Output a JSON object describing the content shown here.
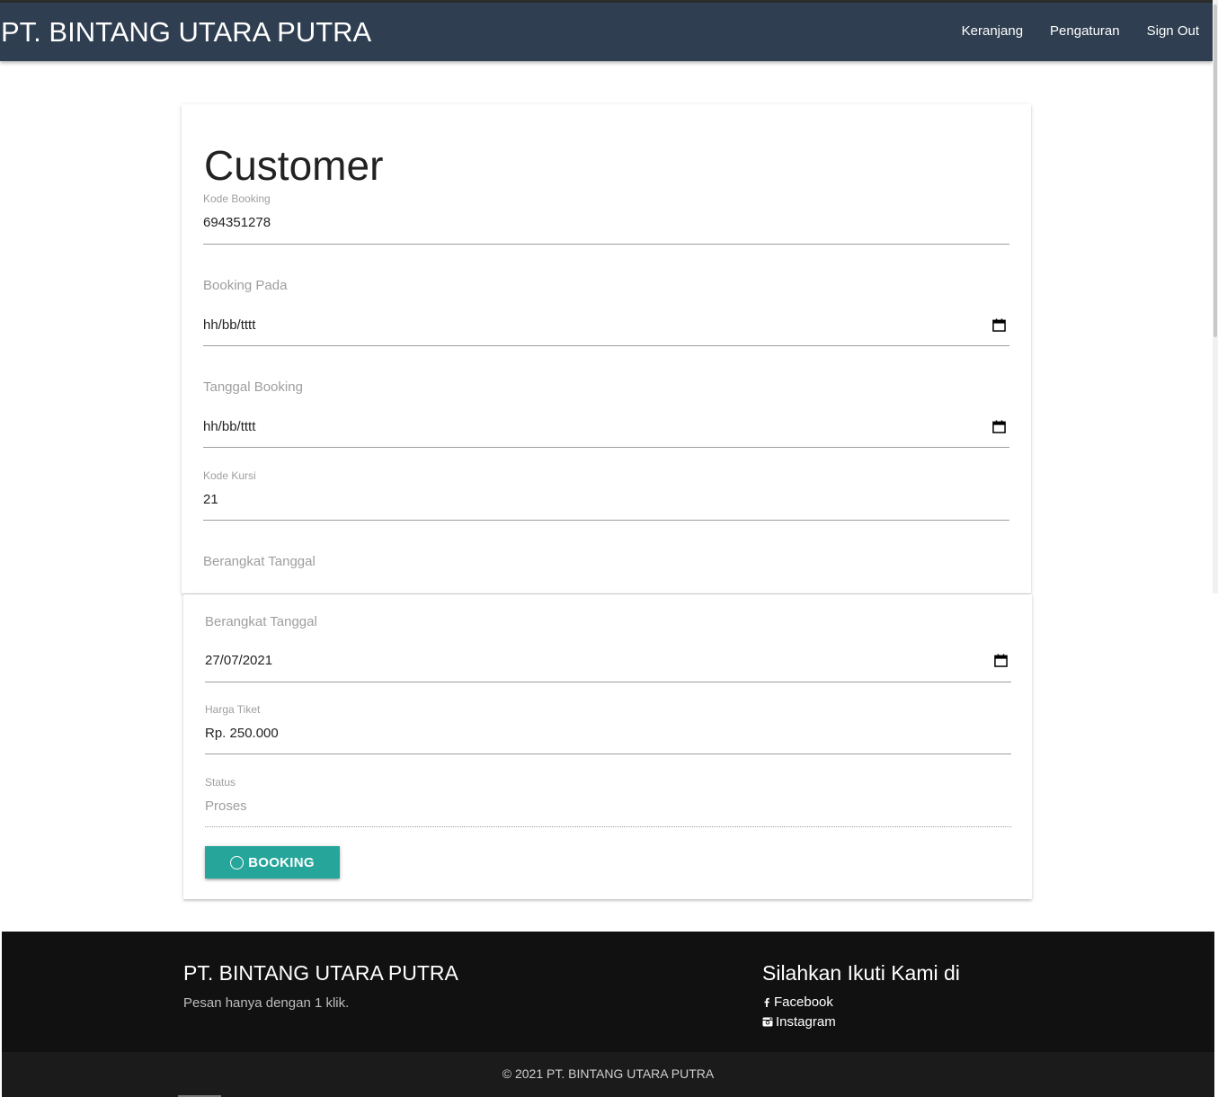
{
  "navbar": {
    "brand": "PT. BINTANG UTARA PUTRA",
    "links": [
      "Keranjang",
      "Pengaturan",
      "Sign Out"
    ]
  },
  "form": {
    "title": "Customer",
    "kode_booking": {
      "label": "Kode Booking",
      "value": "694351278"
    },
    "booking_pada": {
      "label": "Booking Pada",
      "value": "hh/bb/tttt"
    },
    "tanggal_booking": {
      "label": "Tanggal Booking",
      "value": "hh/bb/tttt"
    },
    "kode_kursi": {
      "label": "Kode Kursi",
      "value": "21"
    },
    "berangkat_tanggal_partial": {
      "label": "Berangkat Tanggal"
    },
    "berangkat_tanggal": {
      "label": "Berangkat Tanggal",
      "value": "27/07/2021"
    },
    "harga_tiket": {
      "label": "Harga Tiket",
      "value": "Rp. 250.000"
    },
    "status": {
      "label": "Status",
      "value": "Proses"
    },
    "submit_label": "BOOKING"
  },
  "footer": {
    "title": "PT. BINTANG UTARA PUTRA",
    "tagline": "Pesan hanya dengan 1 klik.",
    "follow_title": "Silahkan Ikuti Kami di",
    "social": [
      {
        "label": "Facebook",
        "icon": "facebook-icon"
      },
      {
        "label": "Instagram",
        "icon": "instagram-icon"
      }
    ],
    "copyright": "© 2021 PT. BINTANG UTARA PUTRA"
  },
  "colors": {
    "navbar": "#2f3e50",
    "button": "#26a69a",
    "footer": "#111111",
    "label": "#9e9e9e"
  }
}
